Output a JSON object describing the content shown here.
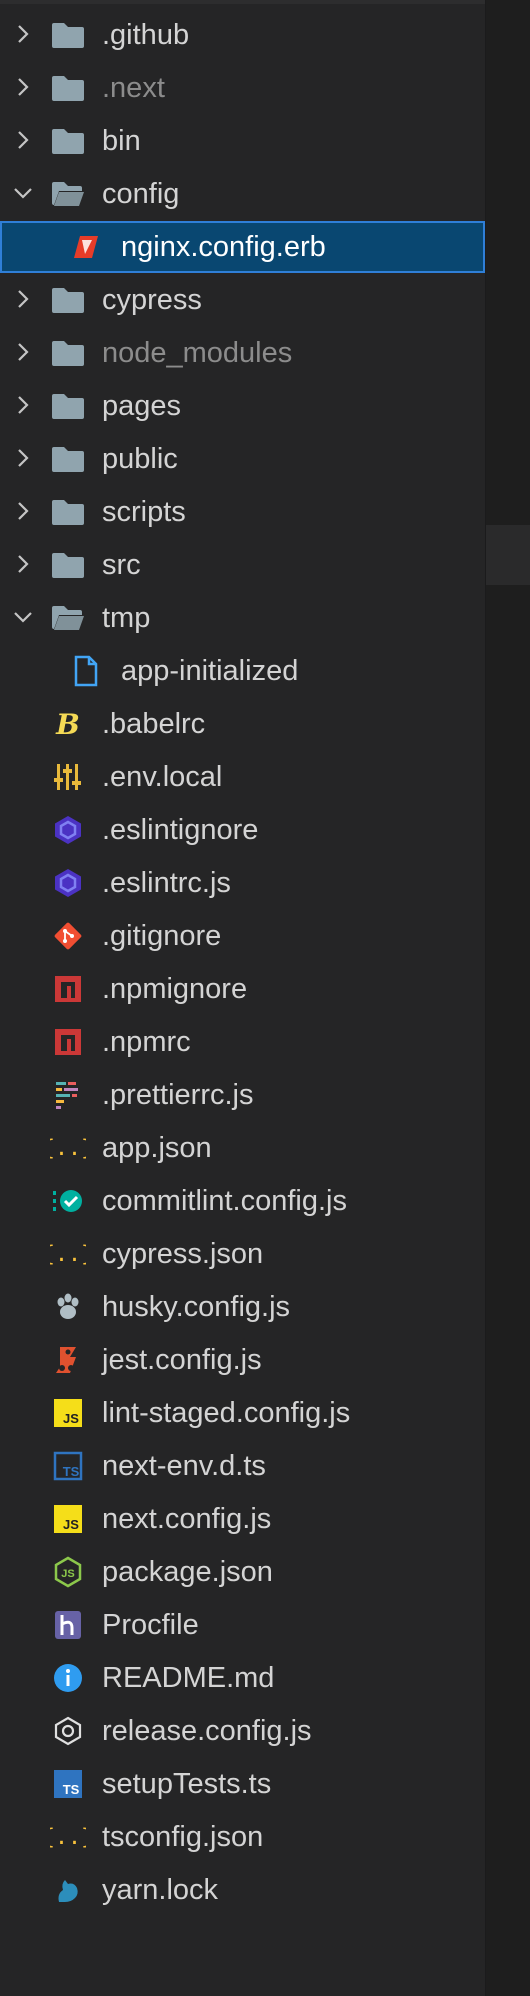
{
  "explorer": {
    "folders_top": [
      {
        "label": ".github",
        "icon": "folder-icon",
        "expanded": false
      },
      {
        "label": ".next",
        "icon": "folder-icon",
        "expanded": false,
        "dim": true
      },
      {
        "label": "bin",
        "icon": "folder-icon",
        "expanded": false
      },
      {
        "label": "config",
        "icon": "folder-open-icon",
        "expanded": true
      }
    ],
    "config_children": [
      {
        "label": "nginx.config.erb",
        "icon": "erb-icon",
        "selected": true
      }
    ],
    "folders_mid": [
      {
        "label": "cypress",
        "icon": "folder-icon",
        "expanded": false
      },
      {
        "label": "node_modules",
        "icon": "folder-icon",
        "expanded": false,
        "dim": true
      },
      {
        "label": "pages",
        "icon": "folder-icon",
        "expanded": false
      },
      {
        "label": "public",
        "icon": "folder-icon",
        "expanded": false
      },
      {
        "label": "scripts",
        "icon": "folder-icon",
        "expanded": false
      },
      {
        "label": "src",
        "icon": "folder-icon",
        "expanded": false
      },
      {
        "label": "tmp",
        "icon": "folder-open-icon",
        "expanded": true
      }
    ],
    "tmp_children": [
      {
        "label": "app-initialized",
        "icon": "file-icon"
      }
    ],
    "files": [
      {
        "label": ".babelrc",
        "icon": "babel-icon"
      },
      {
        "label": ".env.local",
        "icon": "env-icon"
      },
      {
        "label": ".eslintignore",
        "icon": "eslint-icon"
      },
      {
        "label": ".eslintrc.js",
        "icon": "eslint-icon"
      },
      {
        "label": ".gitignore",
        "icon": "git-icon"
      },
      {
        "label": ".npmignore",
        "icon": "npm-icon"
      },
      {
        "label": ".npmrc",
        "icon": "npm-icon"
      },
      {
        "label": ".prettierrc.js",
        "icon": "prettier-icon"
      },
      {
        "label": "app.json",
        "icon": "json-icon"
      },
      {
        "label": "commitlint.config.js",
        "icon": "commitlint-icon"
      },
      {
        "label": "cypress.json",
        "icon": "json-icon"
      },
      {
        "label": "husky.config.js",
        "icon": "husky-icon"
      },
      {
        "label": "jest.config.js",
        "icon": "jest-icon"
      },
      {
        "label": "lint-staged.config.js",
        "icon": "js-icon"
      },
      {
        "label": "next-env.d.ts",
        "icon": "ts-def-icon"
      },
      {
        "label": "next.config.js",
        "icon": "js-icon"
      },
      {
        "label": "package.json",
        "icon": "nodejs-icon"
      },
      {
        "label": "Procfile",
        "icon": "heroku-icon"
      },
      {
        "label": "README.md",
        "icon": "info-icon"
      },
      {
        "label": "release.config.js",
        "icon": "semantic-release-icon"
      },
      {
        "label": "setupTests.ts",
        "icon": "ts-icon"
      },
      {
        "label": "tsconfig.json",
        "icon": "json-icon"
      },
      {
        "label": "yarn.lock",
        "icon": "yarn-icon"
      }
    ]
  },
  "colors": {
    "background": "#252526",
    "selection": "#094771",
    "selection_border": "#2f7fd8",
    "text": "#d4d4d4",
    "dim_text": "#8c8c8c",
    "folder": "#90a4ae",
    "json": "#f9c23c",
    "js": "#f5de19",
    "ts": "#2f74c0",
    "eslint": "#4b32c3",
    "git": "#f14e32",
    "npm": "#cb3837"
  }
}
